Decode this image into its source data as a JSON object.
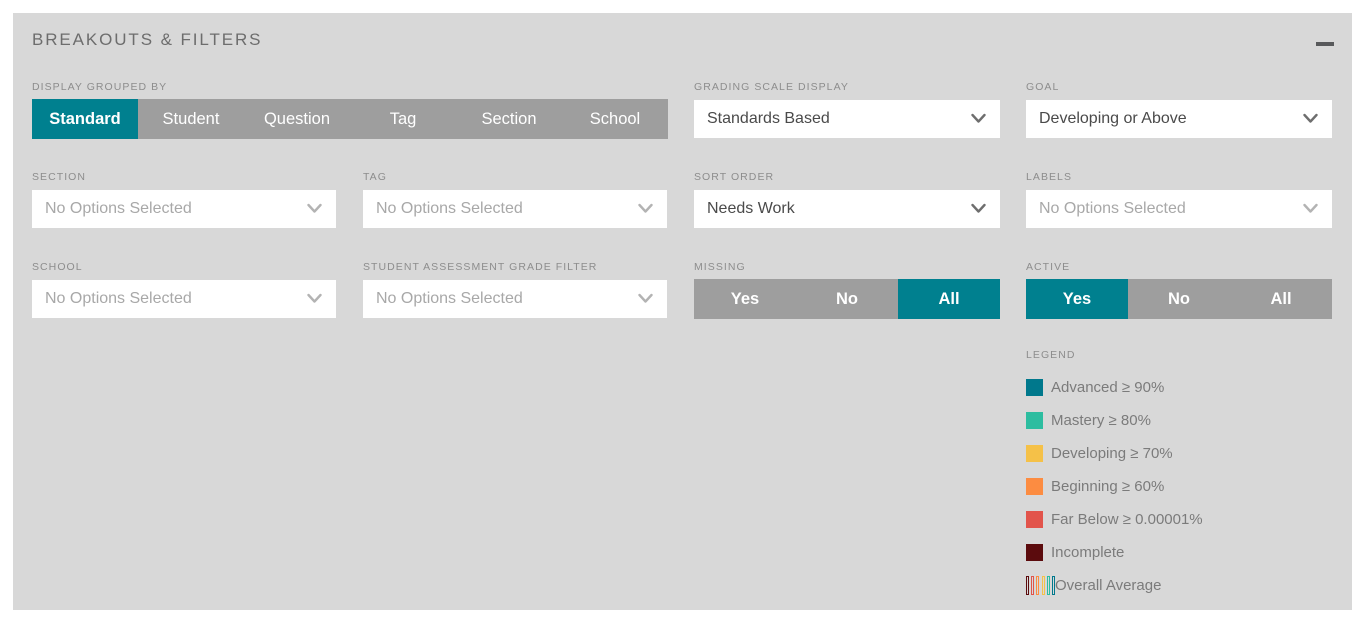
{
  "panel": {
    "title": "BREAKOUTS & FILTERS",
    "collapse_icon": "minus-icon",
    "background_color": "#d8d8d8",
    "accent_color": "#00808f",
    "inactive_color": "#9e9e9e"
  },
  "display_grouped_by": {
    "label": "DISPLAY GROUPED BY",
    "options": [
      "Standard",
      "Student",
      "Question",
      "Tag",
      "Section",
      "School"
    ],
    "selected": "Standard"
  },
  "section": {
    "label": "SECTION",
    "value": "No Options Selected",
    "placeholder": "No Options Selected",
    "is_placeholder": true
  },
  "tag": {
    "label": "TAG",
    "value": "No Options Selected",
    "placeholder": "No Options Selected",
    "is_placeholder": true
  },
  "school": {
    "label": "SCHOOL",
    "value": "No Options Selected",
    "placeholder": "No Options Selected",
    "is_placeholder": true
  },
  "student_assessment_grade_filter": {
    "label": "STUDENT ASSESSMENT GRADE FILTER",
    "value": "No Options Selected",
    "placeholder": "No Options Selected",
    "is_placeholder": true
  },
  "grading_scale_display": {
    "label": "GRADING SCALE DISPLAY",
    "value": "Standards Based",
    "is_placeholder": false
  },
  "sort_order": {
    "label": "SORT ORDER",
    "value": "Needs Work",
    "is_placeholder": false
  },
  "goal": {
    "label": "GOAL",
    "value": "Developing or Above",
    "is_placeholder": false
  },
  "labels_filter": {
    "label": "LABELS",
    "value": "No Options Selected",
    "placeholder": "No Options Selected",
    "is_placeholder": true
  },
  "missing": {
    "label": "MISSING",
    "options": [
      "Yes",
      "No",
      "All"
    ],
    "selected": "All"
  },
  "active": {
    "label": "ACTIVE",
    "options": [
      "Yes",
      "No",
      "All"
    ],
    "selected": "Yes"
  },
  "legend": {
    "label": "LEGEND",
    "items": [
      {
        "text": "Advanced ≥ 90%",
        "color": "#00788c"
      },
      {
        "text": "Mastery ≥ 80%",
        "color": "#2dbda0"
      },
      {
        "text": "Developing ≥ 70%",
        "color": "#f5c148"
      },
      {
        "text": "Beginning ≥ 60%",
        "color": "#fc8c41"
      },
      {
        "text": "Far Below ≥ 0.00001%",
        "color": "#e2544b"
      },
      {
        "text": "Incomplete",
        "color": "#5b0b0d"
      }
    ],
    "overall_average": {
      "text": "Overall Average",
      "colors": [
        "#5b0b0d",
        "#e2544b",
        "#fc8c41",
        "#f5c148",
        "#2dbda0",
        "#00788c"
      ]
    }
  }
}
